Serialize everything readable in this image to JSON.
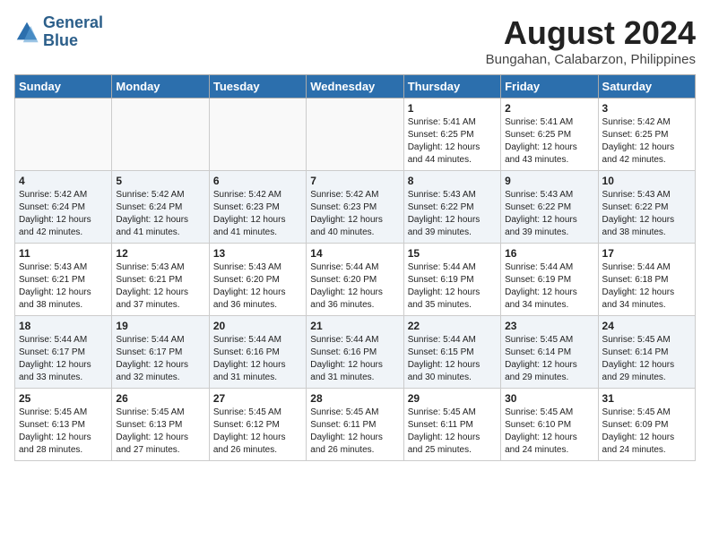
{
  "header": {
    "logo_line1": "General",
    "logo_line2": "Blue",
    "title": "August 2024",
    "subtitle": "Bungahan, Calabarzon, Philippines"
  },
  "calendar": {
    "days_of_week": [
      "Sunday",
      "Monday",
      "Tuesday",
      "Wednesday",
      "Thursday",
      "Friday",
      "Saturday"
    ],
    "weeks": [
      [
        {
          "day": "",
          "info": ""
        },
        {
          "day": "",
          "info": ""
        },
        {
          "day": "",
          "info": ""
        },
        {
          "day": "",
          "info": ""
        },
        {
          "day": "1",
          "info": "Sunrise: 5:41 AM\nSunset: 6:25 PM\nDaylight: 12 hours\nand 44 minutes."
        },
        {
          "day": "2",
          "info": "Sunrise: 5:41 AM\nSunset: 6:25 PM\nDaylight: 12 hours\nand 43 minutes."
        },
        {
          "day": "3",
          "info": "Sunrise: 5:42 AM\nSunset: 6:25 PM\nDaylight: 12 hours\nand 42 minutes."
        }
      ],
      [
        {
          "day": "4",
          "info": "Sunrise: 5:42 AM\nSunset: 6:24 PM\nDaylight: 12 hours\nand 42 minutes."
        },
        {
          "day": "5",
          "info": "Sunrise: 5:42 AM\nSunset: 6:24 PM\nDaylight: 12 hours\nand 41 minutes."
        },
        {
          "day": "6",
          "info": "Sunrise: 5:42 AM\nSunset: 6:23 PM\nDaylight: 12 hours\nand 41 minutes."
        },
        {
          "day": "7",
          "info": "Sunrise: 5:42 AM\nSunset: 6:23 PM\nDaylight: 12 hours\nand 40 minutes."
        },
        {
          "day": "8",
          "info": "Sunrise: 5:43 AM\nSunset: 6:22 PM\nDaylight: 12 hours\nand 39 minutes."
        },
        {
          "day": "9",
          "info": "Sunrise: 5:43 AM\nSunset: 6:22 PM\nDaylight: 12 hours\nand 39 minutes."
        },
        {
          "day": "10",
          "info": "Sunrise: 5:43 AM\nSunset: 6:22 PM\nDaylight: 12 hours\nand 38 minutes."
        }
      ],
      [
        {
          "day": "11",
          "info": "Sunrise: 5:43 AM\nSunset: 6:21 PM\nDaylight: 12 hours\nand 38 minutes."
        },
        {
          "day": "12",
          "info": "Sunrise: 5:43 AM\nSunset: 6:21 PM\nDaylight: 12 hours\nand 37 minutes."
        },
        {
          "day": "13",
          "info": "Sunrise: 5:43 AM\nSunset: 6:20 PM\nDaylight: 12 hours\nand 36 minutes."
        },
        {
          "day": "14",
          "info": "Sunrise: 5:44 AM\nSunset: 6:20 PM\nDaylight: 12 hours\nand 36 minutes."
        },
        {
          "day": "15",
          "info": "Sunrise: 5:44 AM\nSunset: 6:19 PM\nDaylight: 12 hours\nand 35 minutes."
        },
        {
          "day": "16",
          "info": "Sunrise: 5:44 AM\nSunset: 6:19 PM\nDaylight: 12 hours\nand 34 minutes."
        },
        {
          "day": "17",
          "info": "Sunrise: 5:44 AM\nSunset: 6:18 PM\nDaylight: 12 hours\nand 34 minutes."
        }
      ],
      [
        {
          "day": "18",
          "info": "Sunrise: 5:44 AM\nSunset: 6:17 PM\nDaylight: 12 hours\nand 33 minutes."
        },
        {
          "day": "19",
          "info": "Sunrise: 5:44 AM\nSunset: 6:17 PM\nDaylight: 12 hours\nand 32 minutes."
        },
        {
          "day": "20",
          "info": "Sunrise: 5:44 AM\nSunset: 6:16 PM\nDaylight: 12 hours\nand 31 minutes."
        },
        {
          "day": "21",
          "info": "Sunrise: 5:44 AM\nSunset: 6:16 PM\nDaylight: 12 hours\nand 31 minutes."
        },
        {
          "day": "22",
          "info": "Sunrise: 5:44 AM\nSunset: 6:15 PM\nDaylight: 12 hours\nand 30 minutes."
        },
        {
          "day": "23",
          "info": "Sunrise: 5:45 AM\nSunset: 6:14 PM\nDaylight: 12 hours\nand 29 minutes."
        },
        {
          "day": "24",
          "info": "Sunrise: 5:45 AM\nSunset: 6:14 PM\nDaylight: 12 hours\nand 29 minutes."
        }
      ],
      [
        {
          "day": "25",
          "info": "Sunrise: 5:45 AM\nSunset: 6:13 PM\nDaylight: 12 hours\nand 28 minutes."
        },
        {
          "day": "26",
          "info": "Sunrise: 5:45 AM\nSunset: 6:13 PM\nDaylight: 12 hours\nand 27 minutes."
        },
        {
          "day": "27",
          "info": "Sunrise: 5:45 AM\nSunset: 6:12 PM\nDaylight: 12 hours\nand 26 minutes."
        },
        {
          "day": "28",
          "info": "Sunrise: 5:45 AM\nSunset: 6:11 PM\nDaylight: 12 hours\nand 26 minutes."
        },
        {
          "day": "29",
          "info": "Sunrise: 5:45 AM\nSunset: 6:11 PM\nDaylight: 12 hours\nand 25 minutes."
        },
        {
          "day": "30",
          "info": "Sunrise: 5:45 AM\nSunset: 6:10 PM\nDaylight: 12 hours\nand 24 minutes."
        },
        {
          "day": "31",
          "info": "Sunrise: 5:45 AM\nSunset: 6:09 PM\nDaylight: 12 hours\nand 24 minutes."
        }
      ]
    ]
  }
}
